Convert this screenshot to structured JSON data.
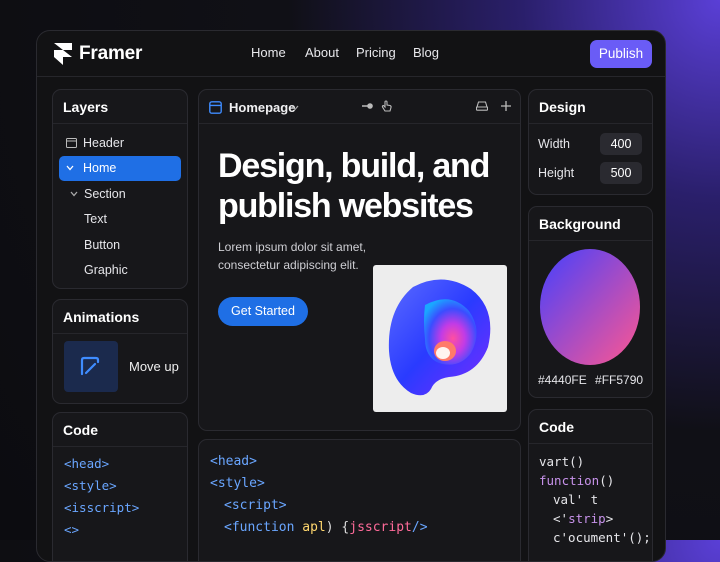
{
  "header": {
    "brand": "Framer",
    "nav": [
      "Home",
      "About",
      "Pricing",
      "Blog"
    ],
    "publish": "Publish"
  },
  "layers": {
    "title": "Layers",
    "items": [
      "Header",
      "Home",
      "Section",
      "Text",
      "Button",
      "Graphic"
    ]
  },
  "animations": {
    "title": "Animations",
    "item": "Move up"
  },
  "code_left": {
    "title": "Code",
    "lines": [
      "<head>",
      "<style>",
      "<isscript>",
      "<>"
    ]
  },
  "canvas": {
    "page": "Homepage",
    "headline_1": "Design, build, and",
    "headline_2": "publish websites",
    "body_1": "Lorem ipsum dolor sit amet,",
    "body_2": "consectetur adipiscing elit.",
    "cta": "Get Started"
  },
  "code_editor": {
    "l1": "<head>",
    "l2": "<style>",
    "l3": "<script>",
    "l4_kw": "<function ",
    "l4_fn": "apl",
    "l4_mid": ") {",
    "l4_str": "jsscript",
    "l4_end": "/>"
  },
  "design": {
    "title": "Design",
    "width_label": "Width",
    "width_value": "400",
    "height_label": "Height",
    "height_value": "500"
  },
  "background": {
    "title": "Background",
    "color_a": "#4440FE",
    "color_b": "#FF5790"
  },
  "code_right": {
    "title": "Code",
    "l1": "vart()",
    "l2_kw": "function",
    "l2_rest": "()",
    "l3": "val' t",
    "l4_a": "<'",
    "l4_str": "strip",
    "l4_b": ">",
    "l5": "c'ocument'();"
  },
  "colors": {
    "accent": "#6a5cf6",
    "selection": "#1f6fe5",
    "cta": "#1f6fe5"
  }
}
